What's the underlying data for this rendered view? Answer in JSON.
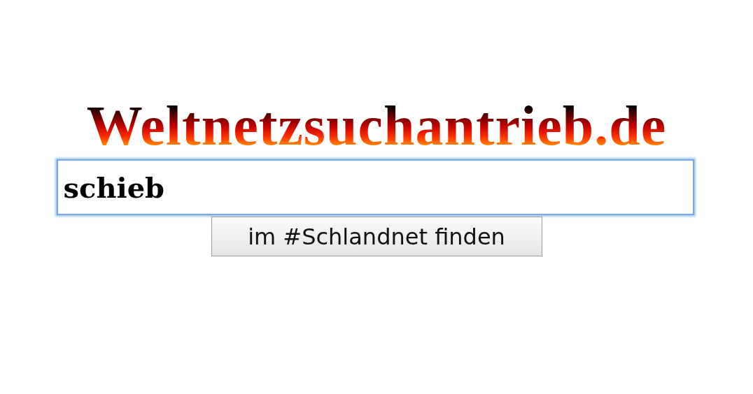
{
  "logo": {
    "text": "Weltnetzsuchantrieb.de"
  },
  "search": {
    "value": "schieb",
    "focused": true
  },
  "button": {
    "label": "im #Schlandnet finden"
  }
}
